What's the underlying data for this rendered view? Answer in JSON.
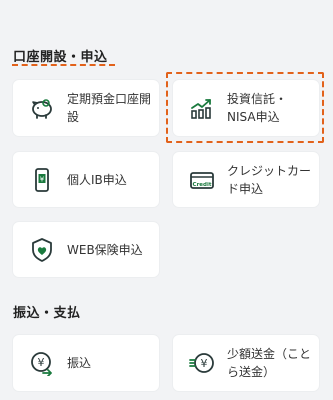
{
  "sections": {
    "account": {
      "title": "口座開設・申込"
    },
    "transfer": {
      "title": "振込・支払"
    }
  },
  "items": {
    "time_deposit": {
      "label": "定期預金口座開\n設",
      "icon": "piggy-bank-icon"
    },
    "investment_nisa": {
      "label": "投資信託・\nNISA申込",
      "icon": "chart-up-icon"
    },
    "ib_application": {
      "label": "個人IB申込",
      "icon": "smartphone-yen-icon"
    },
    "credit_card": {
      "label": "クレジットカー\nド申込",
      "icon": "credit-card-icon",
      "icon_text": "Credit"
    },
    "web_insurance": {
      "label": "WEB保険申込",
      "icon": "shield-heart-icon"
    },
    "transfer": {
      "label": "振込",
      "icon": "yen-arrow-icon"
    },
    "small_remittance": {
      "label": "少額送金（こと\nら送金）",
      "icon": "yen-send-icon"
    }
  },
  "colors": {
    "accent": "#1a7a3e",
    "highlight": "#e2621b"
  }
}
